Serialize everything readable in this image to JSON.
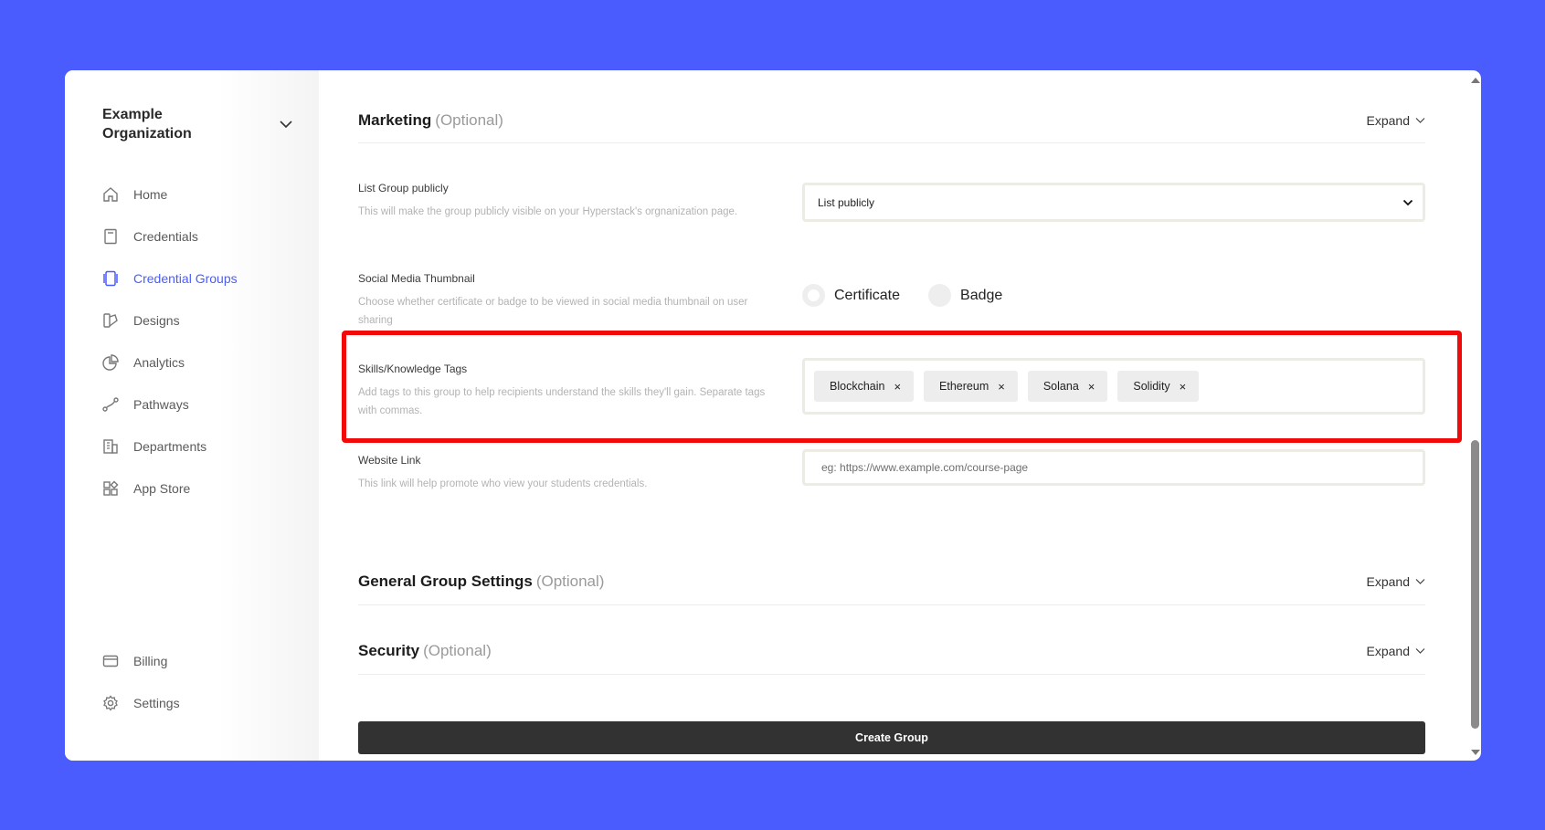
{
  "sidebar": {
    "org_name": "Example Organization",
    "items": [
      {
        "label": "Home",
        "icon": "home-icon"
      },
      {
        "label": "Credentials",
        "icon": "credential-icon"
      },
      {
        "label": "Credential Groups",
        "icon": "credential-groups-icon",
        "active": true
      },
      {
        "label": "Designs",
        "icon": "designs-icon"
      },
      {
        "label": "Analytics",
        "icon": "analytics-icon"
      },
      {
        "label": "Pathways",
        "icon": "pathways-icon"
      },
      {
        "label": "Departments",
        "icon": "departments-icon"
      },
      {
        "label": "App Store",
        "icon": "app-store-icon"
      }
    ],
    "bottom_items": [
      {
        "label": "Billing",
        "icon": "billing-icon"
      },
      {
        "label": "Settings",
        "icon": "gear-icon"
      }
    ]
  },
  "marketing": {
    "title": "Marketing",
    "optional": "(Optional)",
    "expand": "Expand",
    "list_publicly": {
      "label": "List Group publicly",
      "desc": "This will make the group publicly visible on your Hyperstack's orgnanization page.",
      "value": "List publicly"
    },
    "thumbnail": {
      "label": "Social Media Thumbnail",
      "desc": "Choose whether certificate or badge to be viewed in social media thumbnail on user sharing",
      "options": [
        "Certificate",
        "Badge"
      ]
    },
    "tags": {
      "label": "Skills/Knowledge Tags",
      "desc": "Add tags to this group to help recipients understand the skills they'll gain. Separate tags with commas.",
      "values": [
        "Blockchain",
        "Ethereum",
        "Solana",
        "Solidity"
      ],
      "remove": "×"
    },
    "website": {
      "label": "Website Link",
      "desc": "This link will help promote who view your students credentials.",
      "placeholder": "eg: https://www.example.com/course-page"
    }
  },
  "general": {
    "title": "General Group Settings",
    "optional": "(Optional)",
    "expand": "Expand"
  },
  "security": {
    "title": "Security",
    "optional": "(Optional)",
    "expand": "Expand"
  },
  "create_button": "Create Group",
  "colors": {
    "accent": "#4a5cfd",
    "highlight": "#f20a0a",
    "button": "#323232"
  }
}
